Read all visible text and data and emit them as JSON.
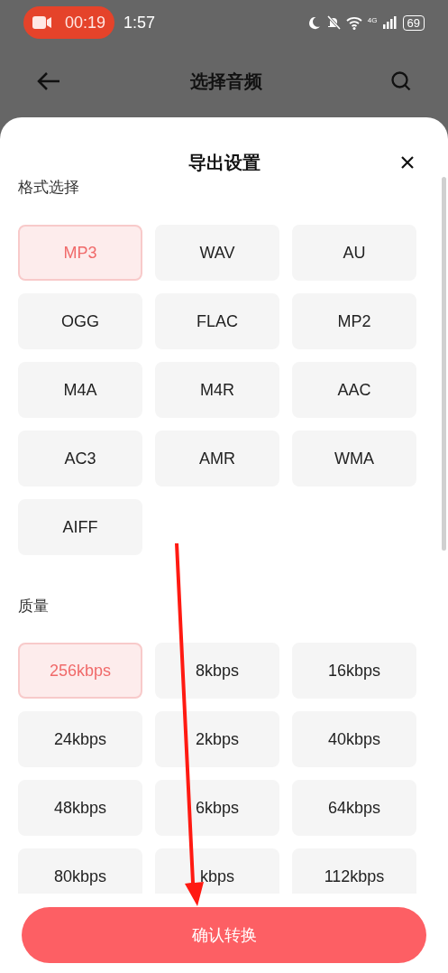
{
  "status_bar": {
    "recording_time": "00:19",
    "time": "1:57",
    "network": "4G",
    "battery": "69"
  },
  "header": {
    "title": "选择音频"
  },
  "sheet": {
    "title": "导出设置",
    "sections": [
      {
        "label": "格式选择",
        "options": [
          {
            "label": "MP3",
            "selected": true
          },
          {
            "label": "WAV",
            "selected": false
          },
          {
            "label": "AU",
            "selected": false
          },
          {
            "label": "OGG",
            "selected": false
          },
          {
            "label": "FLAC",
            "selected": false
          },
          {
            "label": "MP2",
            "selected": false
          },
          {
            "label": "M4A",
            "selected": false
          },
          {
            "label": "M4R",
            "selected": false
          },
          {
            "label": "AAC",
            "selected": false
          },
          {
            "label": "AC3",
            "selected": false
          },
          {
            "label": "AMR",
            "selected": false
          },
          {
            "label": "WMA",
            "selected": false
          },
          {
            "label": "AIFF",
            "selected": false
          }
        ]
      },
      {
        "label": "质量",
        "options": [
          {
            "label": "256kbps",
            "selected": true
          },
          {
            "label": "8kbps",
            "selected": false
          },
          {
            "label": "16kbps",
            "selected": false
          },
          {
            "label": "24kbps",
            "selected": false
          },
          {
            "label": "2kbps",
            "selected": false
          },
          {
            "label": "40kbps",
            "selected": false
          },
          {
            "label": "48kbps",
            "selected": false
          },
          {
            "label": "6kbps",
            "selected": false
          },
          {
            "label": "64kbps",
            "selected": false
          },
          {
            "label": "80kbps",
            "selected": false
          },
          {
            "label": "kbps",
            "selected": false
          },
          {
            "label": "112kbps",
            "selected": false
          }
        ]
      }
    ],
    "confirm_button": "确认转换"
  }
}
